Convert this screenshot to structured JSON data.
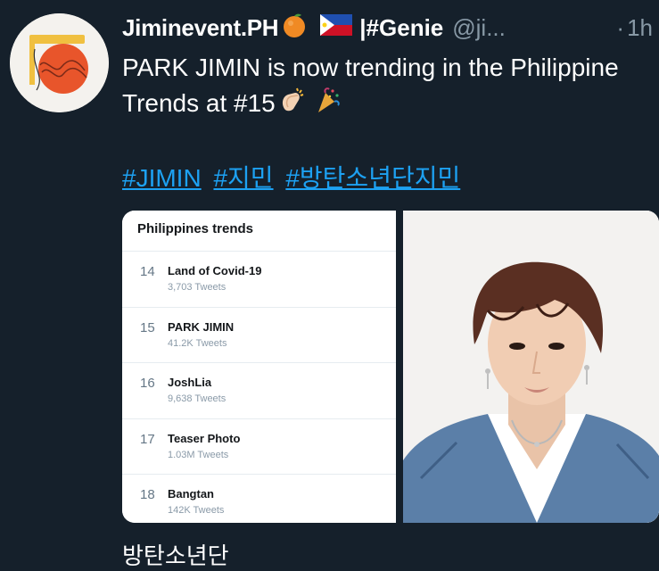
{
  "tweet": {
    "display_name": "Jiminevent.PH",
    "name_suffix": "|#Genie",
    "handle": "@ji...",
    "separator": "·",
    "time": "1h",
    "text": "PARK JIMIN is now trending in the Philippine Trends at #15",
    "hashtags": [
      "#JIMIN",
      "#지민",
      "#방탄소년단지민"
    ],
    "icons": [
      "orange-emoji-icon",
      "philippines-flag-icon",
      "clapping-hands-emoji-icon",
      "party-popper-emoji-icon"
    ]
  },
  "media": {
    "trends_panel": {
      "title": "Philippines trends",
      "items": [
        {
          "rank": "14",
          "name": "Land of Covid-19",
          "count": "3,703 Tweets"
        },
        {
          "rank": "15",
          "name": "PARK JIMIN",
          "count": "41.2K Tweets"
        },
        {
          "rank": "16",
          "name": "JoshLia",
          "count": "9,638 Tweets"
        },
        {
          "rank": "17",
          "name": "Teaser Photo",
          "count": "1.03M Tweets"
        },
        {
          "rank": "18",
          "name": "Bangtan",
          "count": "142K Tweets"
        }
      ]
    }
  },
  "next_text": "방탄소년단",
  "colors": {
    "background": "#15202b",
    "link": "#1da1f2",
    "muted": "#8899a6",
    "avatar_orange": "#e8552b"
  }
}
